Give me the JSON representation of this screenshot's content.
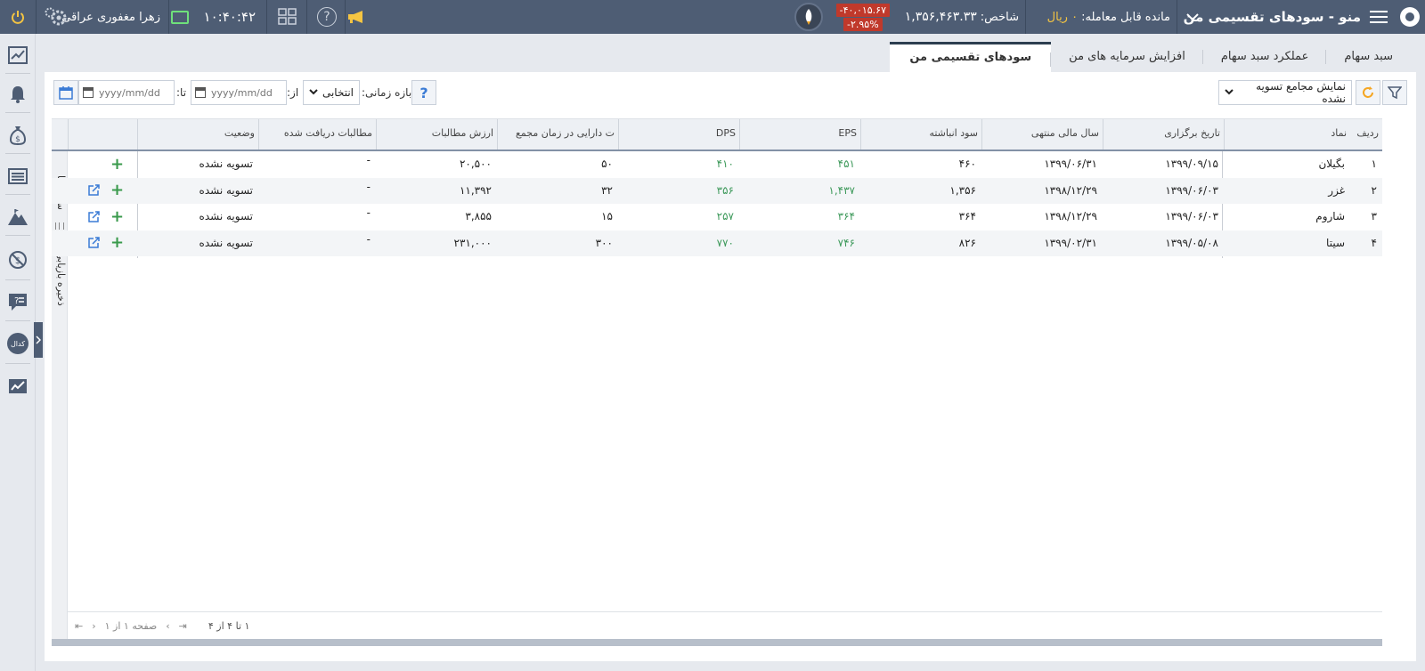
{
  "topbar": {
    "menu_title": "منو - سودهای تقسیمی من",
    "balance_label": "مانده قابل معامله:",
    "balance_value": "۰",
    "balance_unit": "ریال",
    "index_label": "شاخص:",
    "index_value": "۱,۳۵۶,۴۶۳.۳۳",
    "index_change": "-۴۰,۰۱۵.۶۷",
    "index_change_pct": "-۲.۹۵%",
    "clock": "۱۰:۴۰:۴۲",
    "username": "زهرا مغفوری عراقی"
  },
  "sidebar": {
    "items": [
      "chart-icon",
      "bell-icon",
      "money-bag-icon",
      "list-icon",
      "mountain-icon",
      "no-loss-icon",
      "faq-icon",
      "codal-icon",
      "trend-icon"
    ],
    "codal_label": "کدال"
  },
  "tabs": [
    {
      "label": "سبد سهام",
      "active": false
    },
    {
      "label": "عملکرد سبد سهام",
      "active": false
    },
    {
      "label": "افزایش سرمایه های من",
      "active": false
    },
    {
      "label": "سودهای تقسیمی من",
      "active": true
    }
  ],
  "toolbar": {
    "filter_select": "نمایش مجامع تسویه نشده",
    "period_label": "بازه زمانی:",
    "period_select": "انتخابی",
    "from_label": "از:",
    "to_label": "تا:",
    "date_placeholder": "yyyy/mm/dd"
  },
  "grid": {
    "headers": [
      "ردیف",
      "نماد",
      "تاریخ برگزاری",
      "سال مالی منتهی",
      "سود انباشته",
      "EPS",
      "DPS",
      "ت دارایی در زمان مجمع",
      "ارزش مطالبات",
      "مطالبات دریافت شده",
      "وضعیت"
    ],
    "rows": [
      {
        "idx": "۱",
        "symbol": "بگیلان",
        "date": "۱۳۹۹/۰۹/۱۵",
        "fiscal": "۱۳۹۹/۰۶/۳۱",
        "retained": "۴۶۰",
        "eps": "۴۵۱",
        "dps": "۴۱۰",
        "assets": "۵۰",
        "claim": "۲۰,۵۰۰",
        "received": "-",
        "status": "تسویه نشده",
        "ext": false
      },
      {
        "idx": "۲",
        "symbol": "غزر",
        "date": "۱۳۹۹/۰۶/۰۳",
        "fiscal": "۱۳۹۸/۱۲/۲۹",
        "retained": "۱,۳۵۶",
        "eps": "۱,۴۳۷",
        "dps": "۳۵۶",
        "assets": "۳۲",
        "claim": "۱۱,۳۹۲",
        "received": "-",
        "status": "تسویه نشده",
        "ext": true
      },
      {
        "idx": "۳",
        "symbol": "شاروم",
        "date": "۱۳۹۹/۰۶/۰۳",
        "fiscal": "۱۳۹۸/۱۲/۲۹",
        "retained": "۳۶۴",
        "eps": "۳۶۴",
        "dps": "۲۵۷",
        "assets": "۱۵",
        "claim": "۳,۸۵۵",
        "received": "-",
        "status": "تسویه نشده",
        "ext": true
      },
      {
        "idx": "۴",
        "symbol": "سیتا",
        "date": "۱۳۹۹/۰۵/۰۸",
        "fiscal": "۱۳۹۹/۰۲/۳۱",
        "retained": "۸۲۶",
        "eps": "۷۴۶",
        "dps": "۷۷۰",
        "assets": "۳۰۰",
        "claim": "۲۳۱,۰۰۰",
        "received": "-",
        "status": "تسویه نشده",
        "ext": true
      }
    ],
    "strip_columns": "ستون ها",
    "strip_save": "ذخیره بازیابی",
    "footer_range": "۱ تا ۴ از ۴",
    "footer_page": "صفحه ۱ از ۱"
  },
  "colors": {
    "topbar": "#4e5d74",
    "positive": "#3f9a5c",
    "negative_chip": "#c0392b",
    "accent_yellow": "#f5c542"
  }
}
